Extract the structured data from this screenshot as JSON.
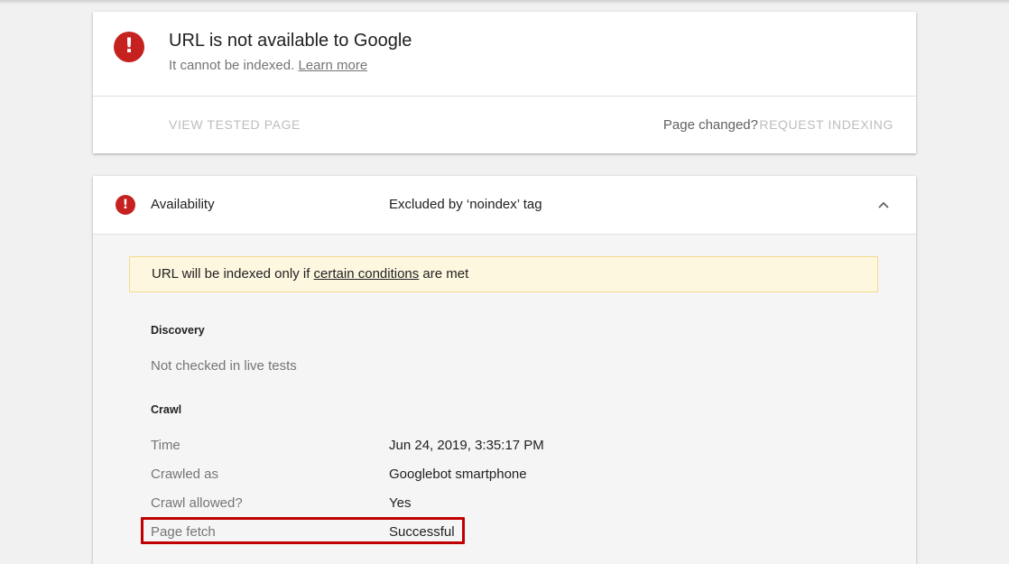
{
  "status_card": {
    "icon": "error-icon",
    "title": "URL is not available to Google",
    "subtitle_text": "It cannot be indexed.",
    "learn_more_label": "Learn more",
    "view_tested_label": "VIEW TESTED PAGE",
    "page_changed_label": "Page changed?",
    "request_indexing_label": "REQUEST INDEXING"
  },
  "availability": {
    "icon": "error-icon",
    "label": "Availability",
    "value": "Excluded by ‘noindex’ tag",
    "expanded": true,
    "banner": {
      "prefix": "URL will be indexed only if ",
      "link_label": "certain conditions",
      "suffix": " are met"
    },
    "discovery": {
      "heading": "Discovery",
      "note": "Not checked in live tests"
    },
    "crawl": {
      "heading": "Crawl",
      "rows": [
        {
          "label": "Time",
          "value": "Jun 24, 2019, 3:35:17 PM"
        },
        {
          "label": "Crawled as",
          "value": "Googlebot smartphone"
        },
        {
          "label": "Crawl allowed?",
          "value": "Yes"
        },
        {
          "label": "Page fetch",
          "value": "Successful"
        }
      ]
    }
  },
  "colors": {
    "error": "#c5221f",
    "banner_bg": "#fef7e0",
    "highlight": "#c00000"
  }
}
